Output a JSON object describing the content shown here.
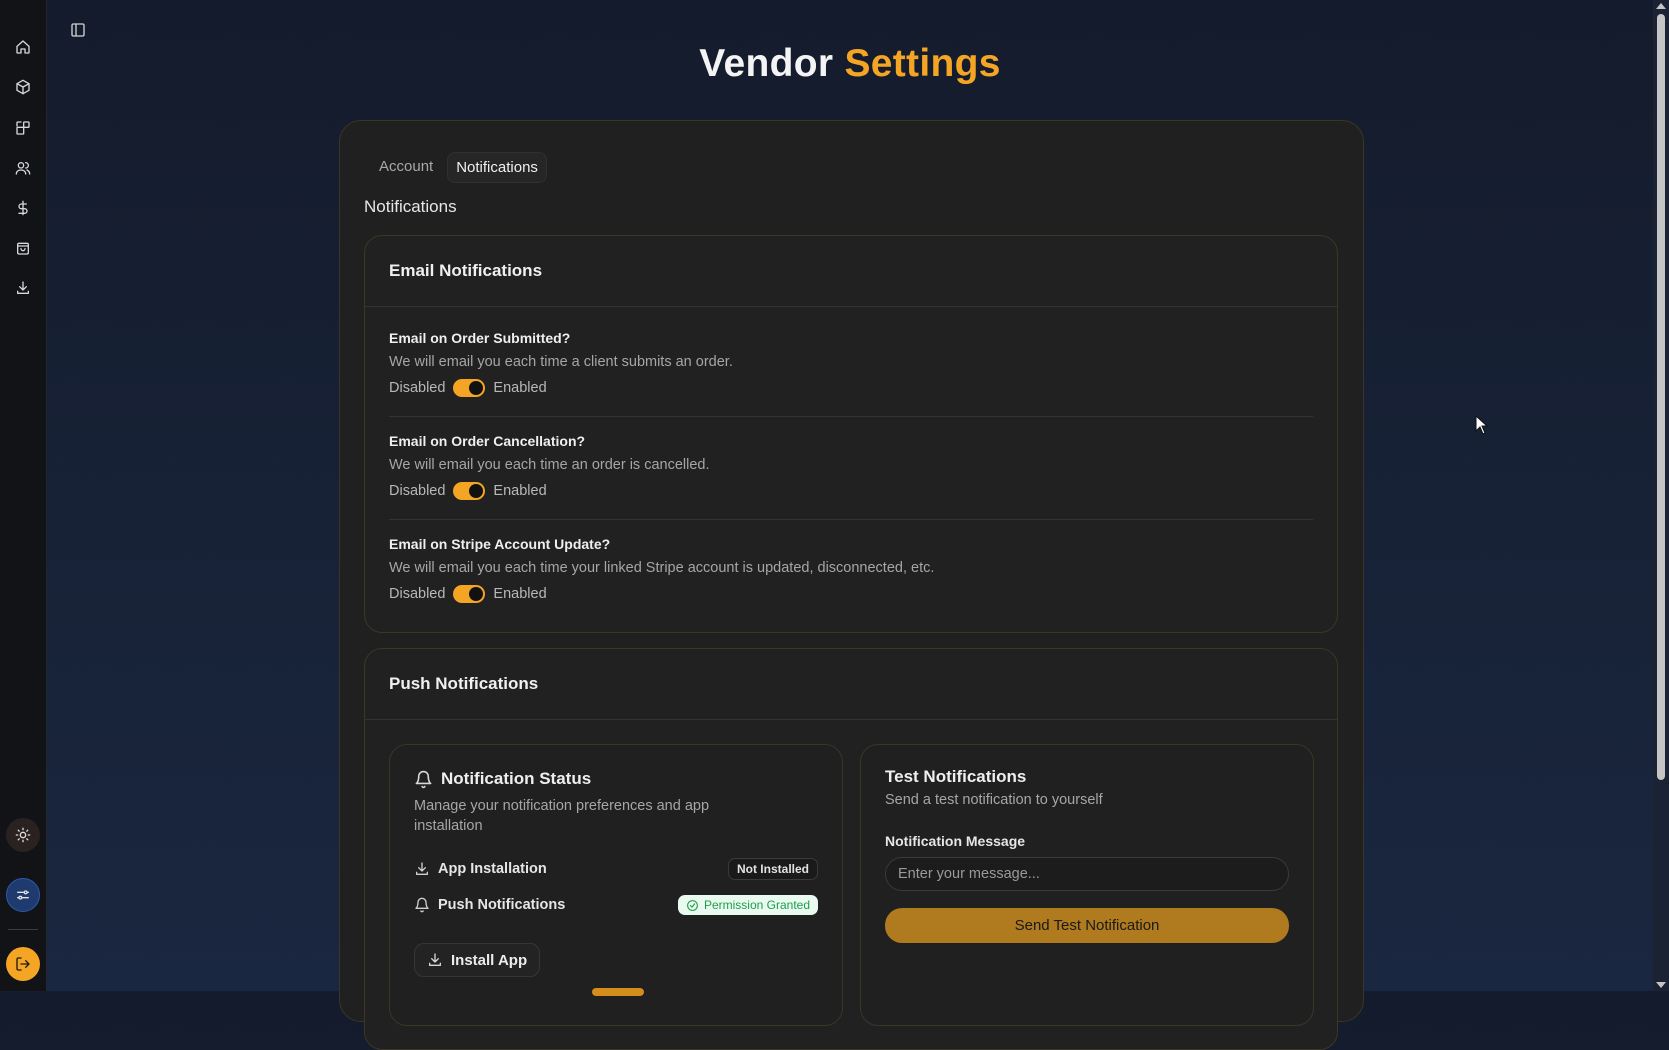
{
  "page": {
    "title_part1": "Vendor",
    "title_part2": "Settings",
    "accent_color": "#f5a524"
  },
  "sidebar": {
    "items": [
      {
        "icon": "home-icon"
      },
      {
        "icon": "package-icon"
      },
      {
        "icon": "shapes-icon"
      },
      {
        "icon": "users-icon"
      },
      {
        "icon": "dollar-icon"
      },
      {
        "icon": "shopping-bag-icon"
      },
      {
        "icon": "download-icon"
      }
    ],
    "bottom": [
      {
        "icon": "sun-icon"
      },
      {
        "icon": "sliders-icon"
      },
      {
        "icon": "logout-icon"
      }
    ]
  },
  "tabs": [
    {
      "label": "Account",
      "active": false
    },
    {
      "label": "Notifications",
      "active": true
    }
  ],
  "section_heading": "Notifications",
  "email": {
    "heading": "Email Notifications",
    "settings": [
      {
        "title": "Email on Order Submitted?",
        "desc": "We will email you each time a client submits an order.",
        "off_label": "Disabled",
        "on_label": "Enabled",
        "enabled": true
      },
      {
        "title": "Email on Order Cancellation?",
        "desc": "We will email you each time an order is cancelled.",
        "off_label": "Disabled",
        "on_label": "Enabled",
        "enabled": true
      },
      {
        "title": "Email on Stripe Account Update?",
        "desc": "We will email you each time your linked Stripe account is updated, disconnected, etc.",
        "off_label": "Disabled",
        "on_label": "Enabled",
        "enabled": true
      }
    ]
  },
  "push": {
    "heading": "Push Notifications",
    "status": {
      "title": "Notification Status",
      "desc": "Manage your notification preferences and app installation",
      "app_label": "App Installation",
      "app_badge": "Not Installed",
      "push_label": "Push Notifications",
      "push_badge": "Permission Granted",
      "install_button": "Install App"
    },
    "test": {
      "title": "Test Notifications",
      "desc": "Send a test notification to yourself",
      "field_label": "Notification Message",
      "placeholder": "Enter your message...",
      "button": "Send Test Notification"
    }
  }
}
